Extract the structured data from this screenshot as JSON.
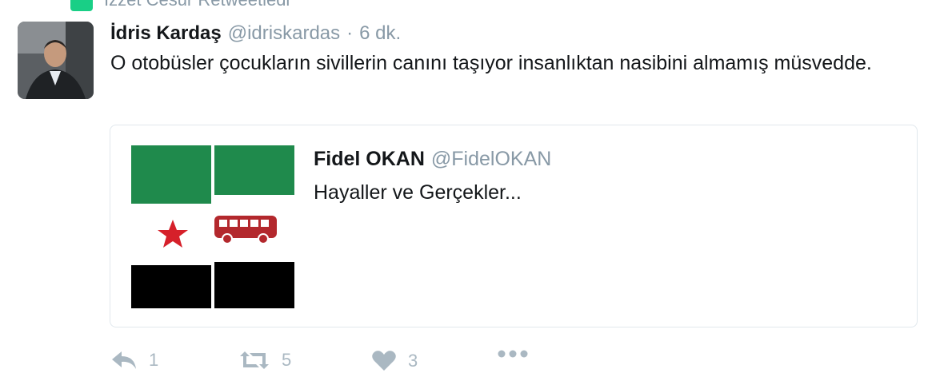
{
  "retweet_context": {
    "text": "İzzet Cesur Retweetledi"
  },
  "tweet": {
    "fullname": "İdris Kardaş",
    "screen_name": "@idriskardas",
    "separator": "·",
    "time": "6 dk.",
    "text": "O otobüsler çocukların sivillerin canını taşıyor insanlıktan nasibini almamış müsvedde."
  },
  "quote": {
    "fullname": "Fidel OKAN",
    "screen_name": "@FidelOKAN",
    "text": "Hayaller ve Gerçekler..."
  },
  "actions": {
    "reply_count": "1",
    "retweet_count": "5",
    "like_count": "3"
  },
  "colors": {
    "accent_muted": "#8899a6",
    "retweet_green": "#19cf86",
    "flag_green": "#1f8a4c",
    "flag_red": "#d6202a",
    "bus_red": "#b3282d"
  },
  "icons": [
    "retweet-icon",
    "reply-icon",
    "like-icon",
    "more-icon"
  ]
}
